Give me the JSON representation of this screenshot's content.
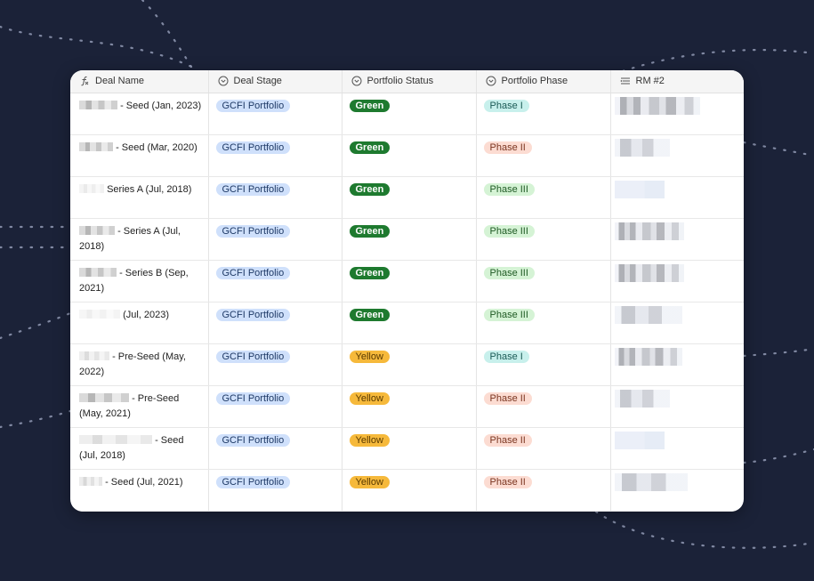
{
  "headers": {
    "deal_name": "Deal Name",
    "deal_stage": "Deal Stage",
    "portfolio_status": "Portfolio Status",
    "portfolio_phase": "Portfolio Phase",
    "rm2": "RM #2"
  },
  "header_icons": {
    "deal_name": "formula-icon",
    "deal_stage": "single-select-icon",
    "portfolio_status": "single-select-icon",
    "portfolio_phase": "single-select-icon",
    "rm2": "lookup-list-icon"
  },
  "colors": {
    "background": "#1b2238",
    "stage_pill": "#cfe0fb",
    "status_green": "#1e7a2f",
    "status_yellow": "#f6b93b",
    "phase_i": "#c8f0ec",
    "phase_ii": "#fcdcd2",
    "phase_iii": "#d5f3d5"
  },
  "rows": [
    {
      "deal_name_suffix": "- Seed (Jan, 2023)",
      "deal_stage": "GCFI Portfolio",
      "portfolio_status": "Green",
      "portfolio_phase": "Phase I"
    },
    {
      "deal_name_suffix": "- Seed (Mar, 2020)",
      "deal_stage": "GCFI Portfolio",
      "portfolio_status": "Green",
      "portfolio_phase": "Phase II"
    },
    {
      "deal_name_suffix": "Series A (Jul, 2018)",
      "deal_stage": "GCFI Portfolio",
      "portfolio_status": "Green",
      "portfolio_phase": "Phase III"
    },
    {
      "deal_name_suffix": "- Series A (Jul, 2018)",
      "deal_stage": "GCFI Portfolio",
      "portfolio_status": "Green",
      "portfolio_phase": "Phase III"
    },
    {
      "deal_name_suffix": "- Series B (Sep, 2021)",
      "deal_stage": "GCFI Portfolio",
      "portfolio_status": "Green",
      "portfolio_phase": "Phase III"
    },
    {
      "deal_name_suffix": "(Jul, 2023)",
      "deal_stage": "GCFI Portfolio",
      "portfolio_status": "Green",
      "portfolio_phase": "Phase III"
    },
    {
      "deal_name_suffix": "- Pre-Seed (May, 2022)",
      "deal_stage": "GCFI Portfolio",
      "portfolio_status": "Yellow",
      "portfolio_phase": "Phase I"
    },
    {
      "deal_name_suffix": "- Pre-Seed (May, 2021)",
      "deal_stage": "GCFI Portfolio",
      "portfolio_status": "Yellow",
      "portfolio_phase": "Phase II"
    },
    {
      "deal_name_suffix": "- Seed (Jul, 2018)",
      "deal_stage": "GCFI Portfolio",
      "portfolio_status": "Yellow",
      "portfolio_phase": "Phase II"
    },
    {
      "deal_name_suffix": "- Seed (Jul, 2021)",
      "deal_stage": "GCFI Portfolio",
      "portfolio_status": "Yellow",
      "portfolio_phase": "Phase II"
    }
  ]
}
